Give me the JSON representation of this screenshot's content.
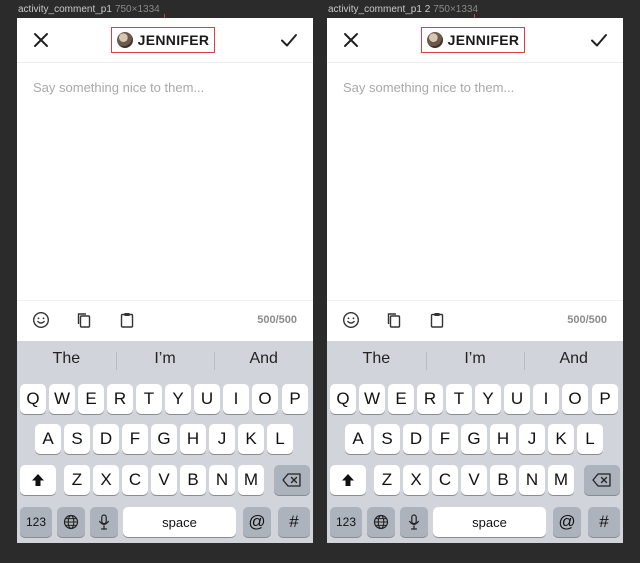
{
  "artboards": [
    {
      "label": "activity_comment_p1",
      "dimensions": "750×1334",
      "title": "JENNIFER",
      "placeholder": "Say something nice to them...",
      "counter": "500/500",
      "predictions": [
        "The",
        "I’m",
        "And"
      ]
    },
    {
      "label": "activity_comment_p1 2",
      "dimensions": "750×1334",
      "title": "JENNIFER",
      "placeholder": "Say something nice to them...",
      "counter": "500/500",
      "predictions": [
        "The",
        "I’m",
        "And"
      ]
    }
  ],
  "keyboard": {
    "row1": [
      "Q",
      "W",
      "E",
      "R",
      "T",
      "Y",
      "U",
      "I",
      "O",
      "P"
    ],
    "row2": [
      "A",
      "S",
      "D",
      "F",
      "G",
      "H",
      "J",
      "K",
      "L"
    ],
    "row3": [
      "Z",
      "X",
      "C",
      "V",
      "B",
      "N",
      "M"
    ],
    "numbers_label": "123",
    "space_label": "space",
    "at_label": "@",
    "hash_label": "#"
  },
  "icons": {
    "close": "close-icon",
    "confirm": "checkmark-icon",
    "avatar": "avatar-image",
    "emoji": "smiley-icon",
    "copy": "copy-icon",
    "paste": "clipboard-icon",
    "shift": "shift-arrow-icon",
    "backspace": "backspace-icon",
    "globe": "globe-icon",
    "mic": "microphone-icon"
  },
  "colors": {
    "background": "#2b2b2b",
    "highlight_box": "#d9414a",
    "keyboard": "#d1d4da"
  }
}
